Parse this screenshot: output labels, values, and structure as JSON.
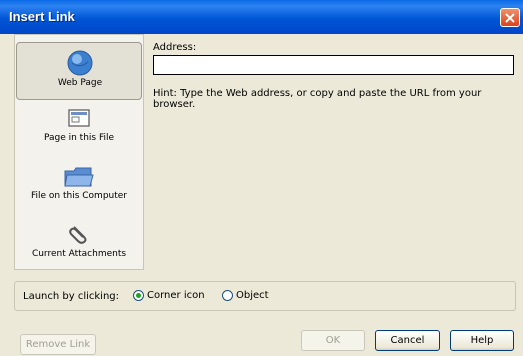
{
  "window": {
    "title": "Insert Link"
  },
  "nav": {
    "items": [
      {
        "label": "Web Page",
        "icon": "globe-icon",
        "selected": true
      },
      {
        "label": "Page in this File",
        "icon": "page-icon",
        "selected": false
      },
      {
        "label": "File on this Computer",
        "icon": "folder-icon",
        "selected": false
      },
      {
        "label": "Current Attachments",
        "icon": "paperclip-icon",
        "selected": false
      }
    ]
  },
  "address": {
    "label": "Address:",
    "value": "",
    "hint": "Hint: Type the Web address, or copy and paste the URL from your browser."
  },
  "launch": {
    "label": "Launch by clicking:",
    "options": [
      {
        "label": "Corner icon",
        "checked": true
      },
      {
        "label": "Object",
        "checked": false
      }
    ]
  },
  "buttons": {
    "remove_link": "Remove Link",
    "ok": "OK",
    "cancel": "Cancel",
    "help": "Help"
  },
  "colors": {
    "titlebar": "#0055d6",
    "close": "#d9431b",
    "radio_checked": "#21a121"
  }
}
